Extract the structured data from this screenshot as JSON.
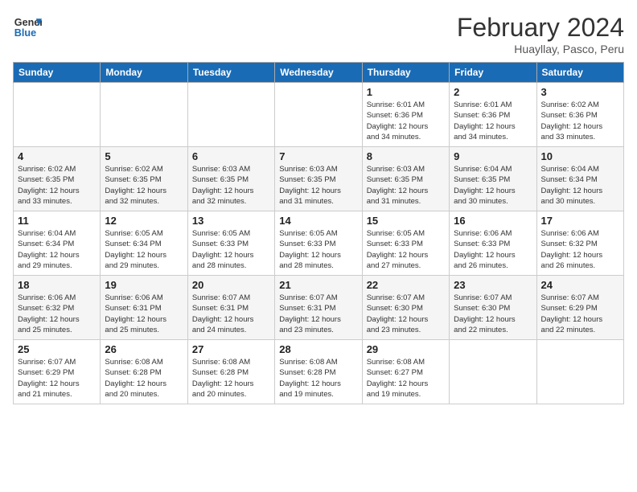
{
  "logo": {
    "line1": "General",
    "line2": "Blue"
  },
  "title": "February 2024",
  "subtitle": "Huayllay, Pasco, Peru",
  "weekdays": [
    "Sunday",
    "Monday",
    "Tuesday",
    "Wednesday",
    "Thursday",
    "Friday",
    "Saturday"
  ],
  "weeks": [
    [
      {
        "day": "",
        "detail": ""
      },
      {
        "day": "",
        "detail": ""
      },
      {
        "day": "",
        "detail": ""
      },
      {
        "day": "",
        "detail": ""
      },
      {
        "day": "1",
        "detail": "Sunrise: 6:01 AM\nSunset: 6:36 PM\nDaylight: 12 hours\nand 34 minutes."
      },
      {
        "day": "2",
        "detail": "Sunrise: 6:01 AM\nSunset: 6:36 PM\nDaylight: 12 hours\nand 34 minutes."
      },
      {
        "day": "3",
        "detail": "Sunrise: 6:02 AM\nSunset: 6:36 PM\nDaylight: 12 hours\nand 33 minutes."
      }
    ],
    [
      {
        "day": "4",
        "detail": "Sunrise: 6:02 AM\nSunset: 6:35 PM\nDaylight: 12 hours\nand 33 minutes."
      },
      {
        "day": "5",
        "detail": "Sunrise: 6:02 AM\nSunset: 6:35 PM\nDaylight: 12 hours\nand 32 minutes."
      },
      {
        "day": "6",
        "detail": "Sunrise: 6:03 AM\nSunset: 6:35 PM\nDaylight: 12 hours\nand 32 minutes."
      },
      {
        "day": "7",
        "detail": "Sunrise: 6:03 AM\nSunset: 6:35 PM\nDaylight: 12 hours\nand 31 minutes."
      },
      {
        "day": "8",
        "detail": "Sunrise: 6:03 AM\nSunset: 6:35 PM\nDaylight: 12 hours\nand 31 minutes."
      },
      {
        "day": "9",
        "detail": "Sunrise: 6:04 AM\nSunset: 6:35 PM\nDaylight: 12 hours\nand 30 minutes."
      },
      {
        "day": "10",
        "detail": "Sunrise: 6:04 AM\nSunset: 6:34 PM\nDaylight: 12 hours\nand 30 minutes."
      }
    ],
    [
      {
        "day": "11",
        "detail": "Sunrise: 6:04 AM\nSunset: 6:34 PM\nDaylight: 12 hours\nand 29 minutes."
      },
      {
        "day": "12",
        "detail": "Sunrise: 6:05 AM\nSunset: 6:34 PM\nDaylight: 12 hours\nand 29 minutes."
      },
      {
        "day": "13",
        "detail": "Sunrise: 6:05 AM\nSunset: 6:33 PM\nDaylight: 12 hours\nand 28 minutes."
      },
      {
        "day": "14",
        "detail": "Sunrise: 6:05 AM\nSunset: 6:33 PM\nDaylight: 12 hours\nand 28 minutes."
      },
      {
        "day": "15",
        "detail": "Sunrise: 6:05 AM\nSunset: 6:33 PM\nDaylight: 12 hours\nand 27 minutes."
      },
      {
        "day": "16",
        "detail": "Sunrise: 6:06 AM\nSunset: 6:33 PM\nDaylight: 12 hours\nand 26 minutes."
      },
      {
        "day": "17",
        "detail": "Sunrise: 6:06 AM\nSunset: 6:32 PM\nDaylight: 12 hours\nand 26 minutes."
      }
    ],
    [
      {
        "day": "18",
        "detail": "Sunrise: 6:06 AM\nSunset: 6:32 PM\nDaylight: 12 hours\nand 25 minutes."
      },
      {
        "day": "19",
        "detail": "Sunrise: 6:06 AM\nSunset: 6:31 PM\nDaylight: 12 hours\nand 25 minutes."
      },
      {
        "day": "20",
        "detail": "Sunrise: 6:07 AM\nSunset: 6:31 PM\nDaylight: 12 hours\nand 24 minutes."
      },
      {
        "day": "21",
        "detail": "Sunrise: 6:07 AM\nSunset: 6:31 PM\nDaylight: 12 hours\nand 23 minutes."
      },
      {
        "day": "22",
        "detail": "Sunrise: 6:07 AM\nSunset: 6:30 PM\nDaylight: 12 hours\nand 23 minutes."
      },
      {
        "day": "23",
        "detail": "Sunrise: 6:07 AM\nSunset: 6:30 PM\nDaylight: 12 hours\nand 22 minutes."
      },
      {
        "day": "24",
        "detail": "Sunrise: 6:07 AM\nSunset: 6:29 PM\nDaylight: 12 hours\nand 22 minutes."
      }
    ],
    [
      {
        "day": "25",
        "detail": "Sunrise: 6:07 AM\nSunset: 6:29 PM\nDaylight: 12 hours\nand 21 minutes."
      },
      {
        "day": "26",
        "detail": "Sunrise: 6:08 AM\nSunset: 6:28 PM\nDaylight: 12 hours\nand 20 minutes."
      },
      {
        "day": "27",
        "detail": "Sunrise: 6:08 AM\nSunset: 6:28 PM\nDaylight: 12 hours\nand 20 minutes."
      },
      {
        "day": "28",
        "detail": "Sunrise: 6:08 AM\nSunset: 6:28 PM\nDaylight: 12 hours\nand 19 minutes."
      },
      {
        "day": "29",
        "detail": "Sunrise: 6:08 AM\nSunset: 6:27 PM\nDaylight: 12 hours\nand 19 minutes."
      },
      {
        "day": "",
        "detail": ""
      },
      {
        "day": "",
        "detail": ""
      }
    ]
  ]
}
